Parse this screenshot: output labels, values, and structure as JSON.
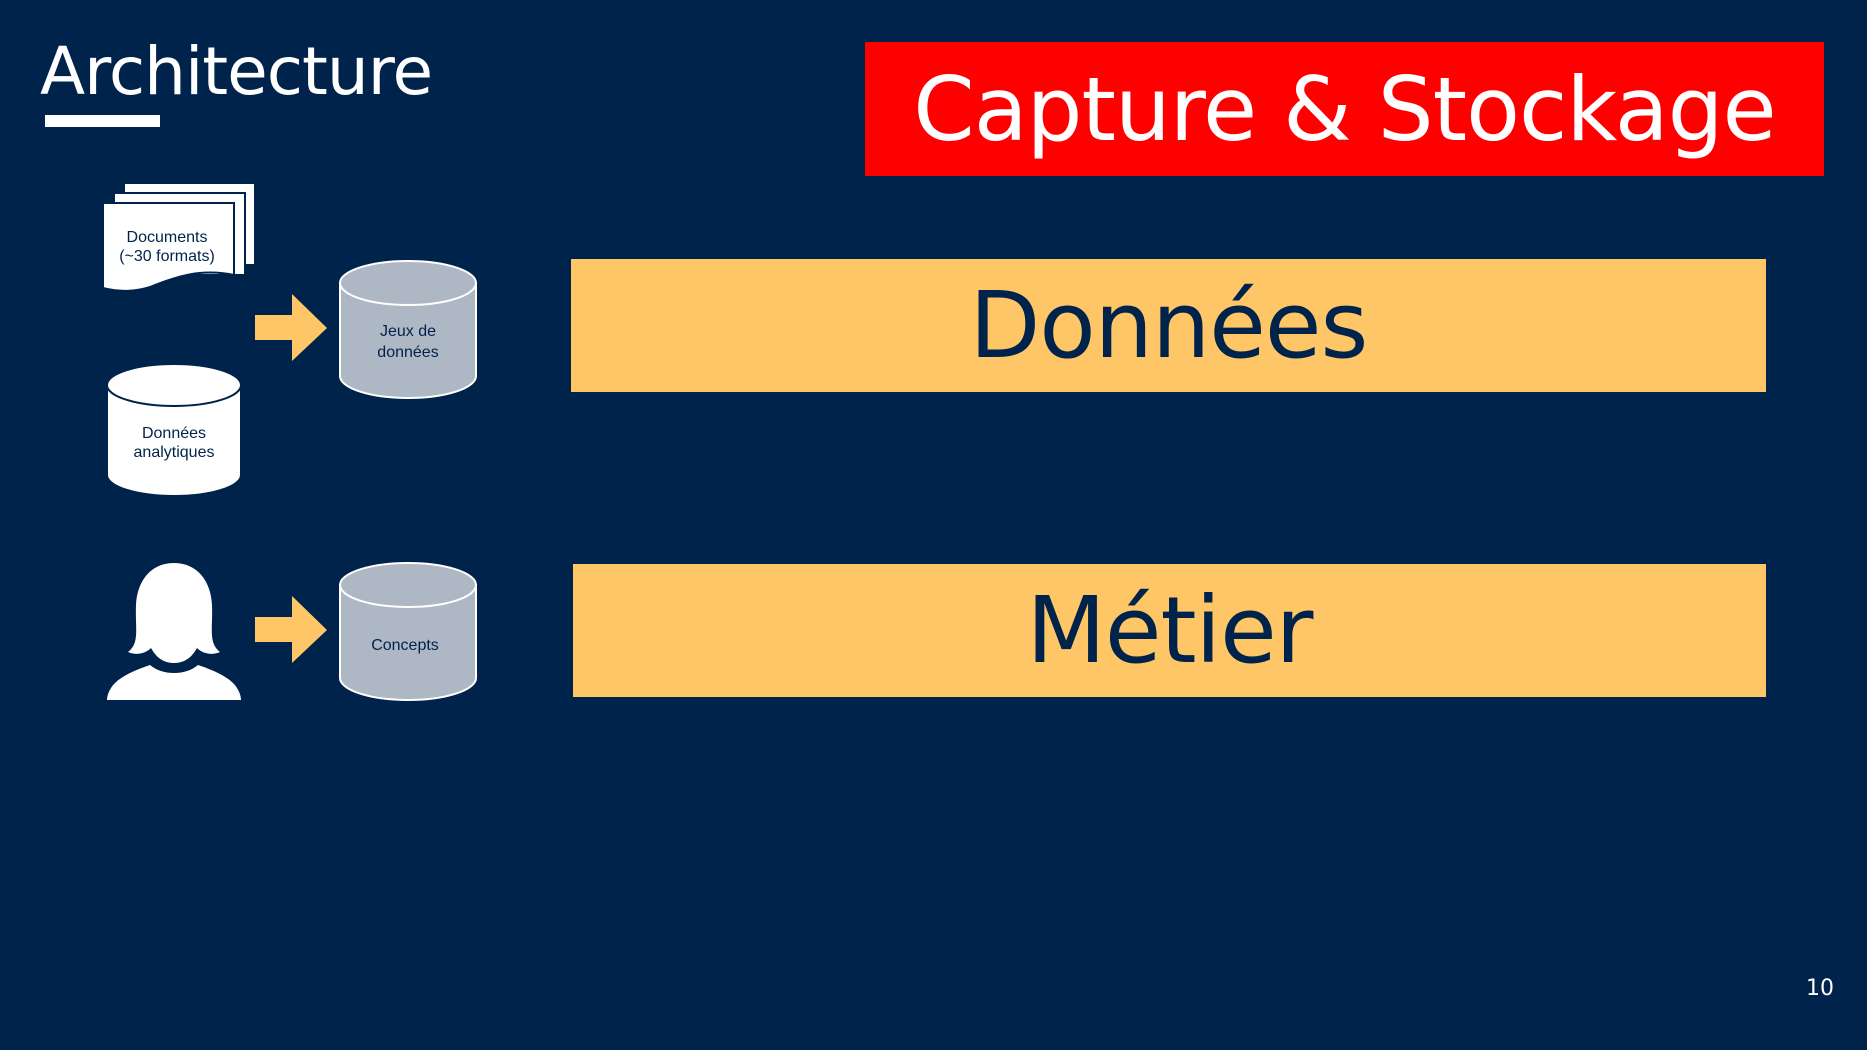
{
  "slide": {
    "title": "Architecture",
    "badge": "Capture & Stockage",
    "page_number": "10"
  },
  "bands": {
    "data": "Données",
    "business": "Métier"
  },
  "diagram": {
    "documents_line1": "Documents",
    "documents_line2": "(~30 formats)",
    "analytics_line1": "Données",
    "analytics_line2": "analytiques",
    "datasets_line1": "Jeux de",
    "datasets_line2": "données",
    "concepts": "Concepts"
  },
  "colors": {
    "background": "#00234b",
    "badge": "#ff0000",
    "band": "#fec666",
    "arrow": "#fec666",
    "cylinder_gray": "#aeb7c4",
    "white": "#ffffff"
  },
  "icons": {
    "documents": "document-stack-icon",
    "database": "database-cylinder-icon",
    "arrow": "arrow-right-icon",
    "user": "woman-user-icon"
  }
}
